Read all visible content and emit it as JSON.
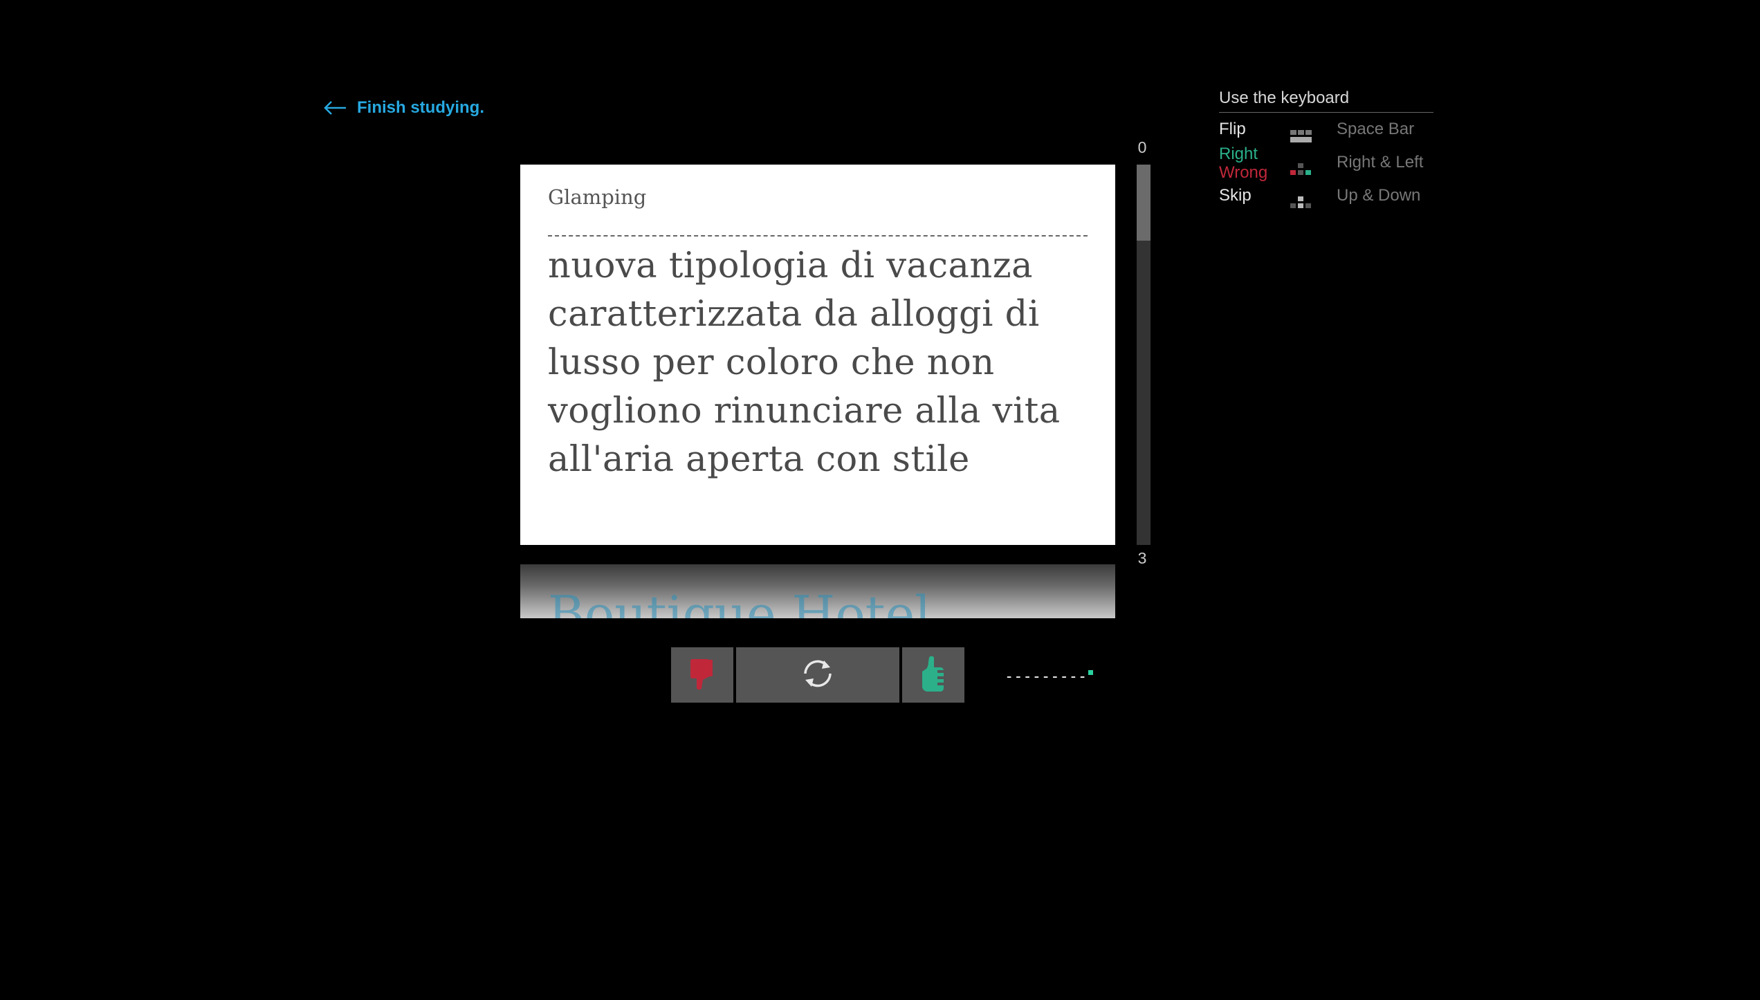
{
  "nav": {
    "finish_label": "Finish studying."
  },
  "card": {
    "term": "Glamping",
    "definition": "nuova tipologia di vacanza caratterizzata da alloggi di lusso per coloro che non vogliono rinunciare alla vita all'aria aperta con stile"
  },
  "next_card": {
    "term": "Boutique Hotel"
  },
  "progress": {
    "top_label": "0",
    "bottom_label": "3",
    "fraction": 0.2
  },
  "keyboard_help": {
    "title": "Use the keyboard",
    "rows": [
      {
        "action": "Flip",
        "keys": "Space Bar"
      },
      {
        "action": "Right",
        "action2": "Wrong",
        "keys": "Right & Left"
      },
      {
        "action": "Skip",
        "keys": "Up & Down"
      }
    ]
  },
  "controls": {
    "wrong_icon": "thumbs-down-icon",
    "flip_icon": "refresh-icon",
    "right_icon": "thumbs-up-icon"
  },
  "answer_progress": {
    "dashes": "---------"
  },
  "colors": {
    "accent": "#27a9e1",
    "right": "#2bb08a",
    "wrong": "#c0283a",
    "button_bg": "#555555"
  }
}
